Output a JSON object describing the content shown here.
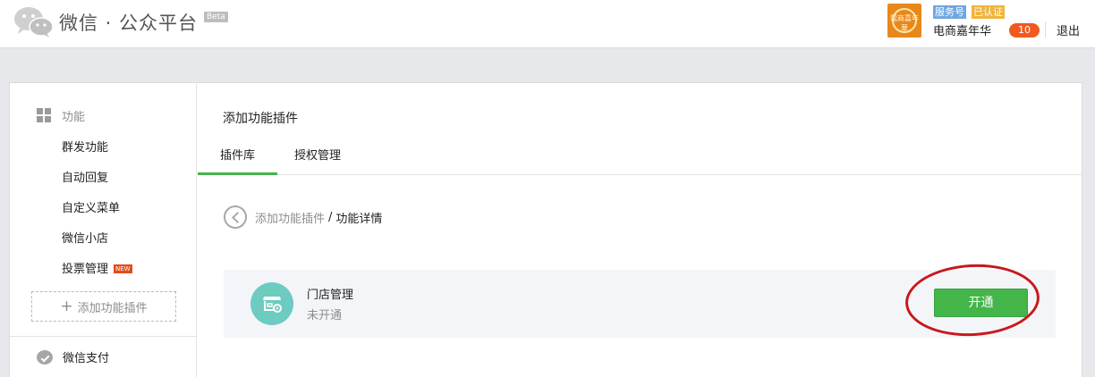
{
  "header": {
    "logo_text": "微信 · 公众平台",
    "beta_label": "Beta",
    "account": {
      "type_badge": "服务号",
      "verified_badge": "已认证",
      "name": "电商嘉年华",
      "message_count": "10",
      "avatar_text": "電商嘉年華"
    },
    "logout_label": "退出"
  },
  "sidebar": {
    "group_label": "功能",
    "items": [
      {
        "label": "群发功能"
      },
      {
        "label": "自动回复"
      },
      {
        "label": "自定义菜单"
      },
      {
        "label": "微信小店"
      },
      {
        "label": "投票管理",
        "tag": "NEW"
      }
    ],
    "add_plugin_label": "添加功能插件",
    "pay_label": "微信支付"
  },
  "main": {
    "title": "添加功能插件",
    "tabs": [
      {
        "label": "插件库",
        "active": true
      },
      {
        "label": "授权管理",
        "active": false
      }
    ],
    "breadcrumb": {
      "parent": "添加功能插件",
      "separator": "/",
      "current": "功能详情"
    },
    "plugin": {
      "name": "门店管理",
      "status": "未开通",
      "action_label": "开通",
      "icon": "store-icon"
    }
  },
  "colors": {
    "accent_green": "#44b549",
    "plugin_icon_bg": "#6dcbc0",
    "badge_red": "#f05a1e",
    "annotation_red": "#c8181b"
  }
}
